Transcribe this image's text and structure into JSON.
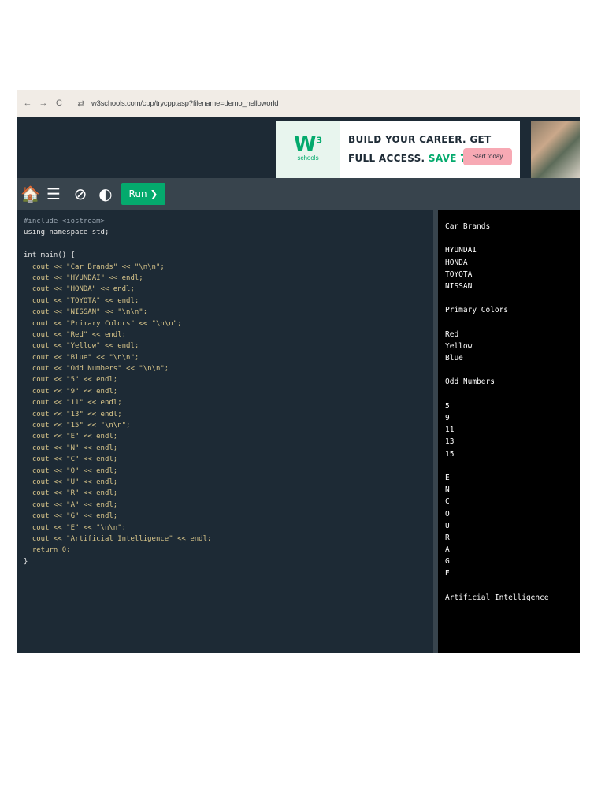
{
  "browser": {
    "url": "w3schools.com/cpp/trycpp.asp?filename=demo_helloworld",
    "back_icon": "←",
    "forward_icon": "→",
    "reload_icon": "C",
    "site_settings_icon": "⇄"
  },
  "ad": {
    "logo_text": "W",
    "logo_sup": "3",
    "logo_sub": "schools",
    "line1": "BUILD YOUR CAREER. GET",
    "line2_prefix": "FULL ACCESS.",
    "line2_highlight": "SAVE 770$",
    "button_label": "Start today"
  },
  "toolbar": {
    "home_icon": "🏠",
    "menu_icon": "☰",
    "orientation_icon": "⊘",
    "theme_icon": "◐",
    "run_label": "Run ❯"
  },
  "code_lines": [
    "#include <iostream>",
    "using namespace std;",
    "",
    "int main() {",
    "  cout << \"Car Brands\" << \"\\n\\n\";",
    "  cout << \"HYUNDAI\" << endl;",
    "  cout << \"HONDA\" << endl;",
    "  cout << \"TOYOTA\" << endl;",
    "  cout << \"NISSAN\" << \"\\n\\n\";",
    "  cout << \"Primary Colors\" << \"\\n\\n\";",
    "  cout << \"Red\" << endl;",
    "  cout << \"Yellow\" << endl;",
    "  cout << \"Blue\" << \"\\n\\n\";",
    "  cout << \"Odd Numbers\" << \"\\n\\n\";",
    "  cout << \"5\" << endl;",
    "  cout << \"9\" << endl;",
    "  cout << \"11\" << endl;",
    "  cout << \"13\" << endl;",
    "  cout << \"15\" << \"\\n\\n\";",
    "  cout << \"E\" << endl;",
    "  cout << \"N\" << endl;",
    "  cout << \"C\" << endl;",
    "  cout << \"O\" << endl;",
    "  cout << \"U\" << endl;",
    "  cout << \"R\" << endl;",
    "  cout << \"A\" << endl;",
    "  cout << \"G\" << endl;",
    "  cout << \"E\" << \"\\n\\n\";",
    "  cout << \"Artificial Intelligence\" << endl;",
    "  return 0;",
    "}"
  ],
  "output_lines": [
    "Car Brands",
    "",
    "HYUNDAI",
    "HONDA",
    "TOYOTA",
    "NISSAN",
    "",
    "Primary Colors",
    "",
    "Red",
    "Yellow",
    "Blue",
    "",
    "Odd Numbers",
    "",
    "5",
    "9",
    "11",
    "13",
    "15",
    "",
    "E",
    "N",
    "C",
    "O",
    "U",
    "R",
    "A",
    "G",
    "E",
    "",
    "Artificial Intelligence"
  ],
  "colors": {
    "editor_bg": "#1d2a35",
    "toolbar_bg": "#38444d",
    "run_green": "#04aa6d",
    "output_bg": "#000000"
  }
}
